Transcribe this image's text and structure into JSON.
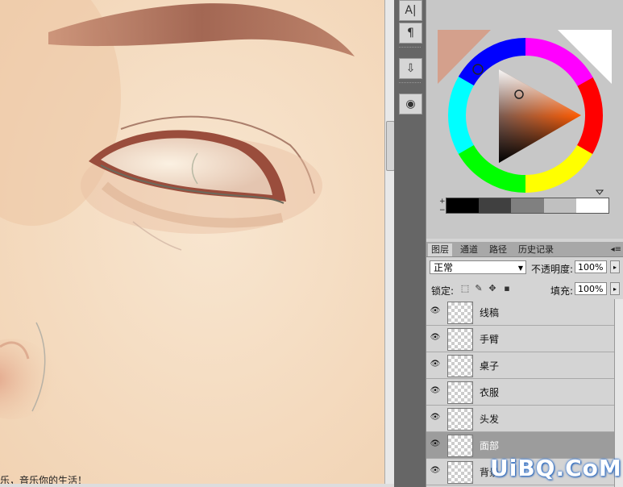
{
  "caption": "乐，音乐你的生活！",
  "tools": [
    {
      "icon": "text-tool-icon",
      "glyph": "A|"
    },
    {
      "icon": "paragraph-icon",
      "glyph": "¶"
    },
    {
      "icon": "clone-source-icon",
      "glyph": "⇩"
    },
    {
      "icon": "brush-preset-icon",
      "glyph": "◉"
    }
  ],
  "color_panel": {
    "foreground_color": "#d4a08c",
    "background_color": "#ffffff",
    "ramp_colors": [
      "#000000",
      "#404040",
      "#808080",
      "#c0c0c0",
      "#ffffff"
    ]
  },
  "layers_panel": {
    "tabs": [
      "图层",
      "通道",
      "路径",
      "历史记录"
    ],
    "active_tab": "图层",
    "blend_mode": "正常",
    "opacity_label": "不透明度:",
    "opacity_value": "100%",
    "lock_label": "锁定:",
    "fill_label": "填充:",
    "fill_value": "100%",
    "layers": [
      {
        "name": "线稿",
        "selected": false
      },
      {
        "name": "手臂",
        "selected": false
      },
      {
        "name": "桌子",
        "selected": false
      },
      {
        "name": "衣服",
        "selected": false
      },
      {
        "name": "头发",
        "selected": false
      },
      {
        "name": "面部",
        "selected": true
      },
      {
        "name": "背景",
        "selected": false
      }
    ]
  },
  "watermark": "UiBQ.CoM"
}
